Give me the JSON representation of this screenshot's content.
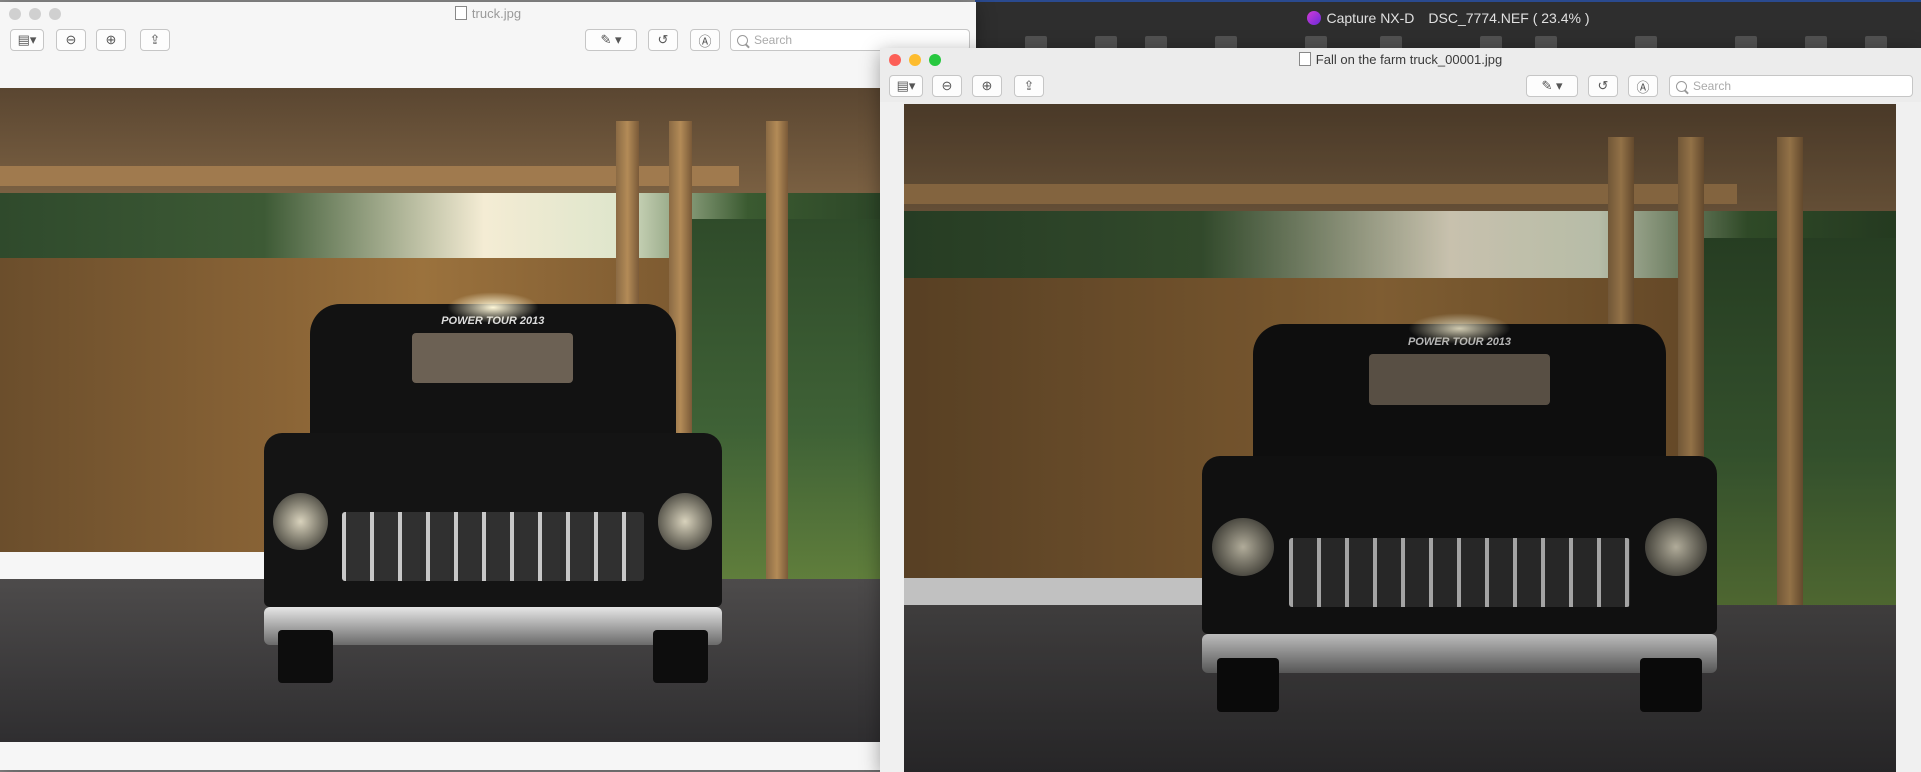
{
  "background_app": {
    "name": "Capture NX-D",
    "document": "DSC_7774.NEF ( 23.4% )"
  },
  "windows": [
    {
      "title": "truck.jpg",
      "active": false,
      "search_placeholder": "Search",
      "image": "truck photo (brighter edit)"
    },
    {
      "title": "Fall on the farm truck_00001.jpg",
      "active": true,
      "search_placeholder": "Search",
      "image": "truck photo (darker edit)"
    }
  ],
  "photo_text": {
    "windshield_banner": "POWER TOUR 2013"
  },
  "colors": {
    "traffic_close": "#fc5f57",
    "traffic_min": "#fdbc2e",
    "traffic_max": "#28c840",
    "traffic_inactive": "#d0d0d0",
    "nxd_accent": "#2a4a8f"
  },
  "icons": {
    "sidebar": "sidebar-toggle-icon",
    "zoom_out": "zoom-out-icon",
    "zoom_in": "zoom-in-icon",
    "share": "share-icon",
    "markup": "pen-markup-icon",
    "rotate": "rotate-icon",
    "annotate": "annotate-icon"
  }
}
